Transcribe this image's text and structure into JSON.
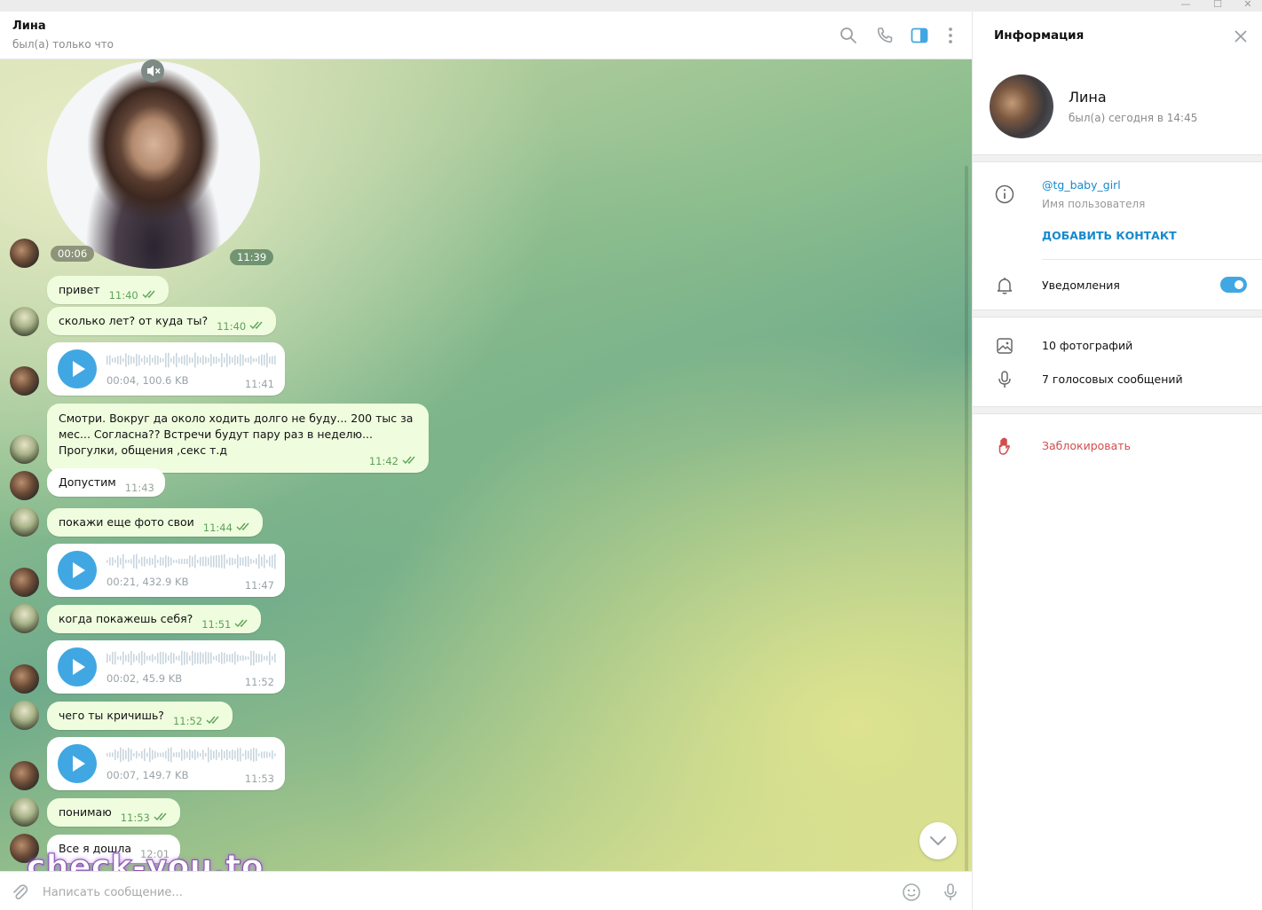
{
  "header": {
    "title": "Лина",
    "status": "был(а) только что"
  },
  "messages": {
    "video_round": {
      "duration": "00:06",
      "time": "11:39"
    },
    "m1": {
      "text": "привет",
      "time": "11:40"
    },
    "m2": {
      "text": "сколько лет? от куда ты?",
      "time": "11:40"
    },
    "v1": {
      "meta": "00:04, 100.6 KB",
      "time": "11:41"
    },
    "m3": {
      "text": "Смотри. Вокруг да около ходить долго не буду... 200 тыс за мес... Согласна?? Встречи будут пару раз в неделю... Прогулки, общения ,секс  т.д",
      "time": "11:42"
    },
    "m4": {
      "text": "Допустим",
      "time": "11:43"
    },
    "m5": {
      "text": "покажи еще фото свои",
      "time": "11:44"
    },
    "v2": {
      "meta": "00:21, 432.9 KB",
      "time": "11:47"
    },
    "m6": {
      "text": "когда покажешь себя?",
      "time": "11:51"
    },
    "v3": {
      "meta": "00:02, 45.9 KB",
      "time": "11:52"
    },
    "m7": {
      "text": "чего ты кричишь?",
      "time": "11:52"
    },
    "v4": {
      "meta": "00:07, 149.7 KB",
      "time": "11:53"
    },
    "m8": {
      "text": "понимаю",
      "time": "11:53"
    },
    "m9": {
      "text": "Все я дошла",
      "time": "12:01"
    }
  },
  "composer": {
    "placeholder": "Написать сообщение..."
  },
  "watermark": "check-you.to",
  "panel": {
    "title": "Информация",
    "name": "Лина",
    "status": "был(а) сегодня в 14:45",
    "username": "@tg_baby_girl",
    "username_label": "Имя пользователя",
    "add_contact": "ДОБАВИТЬ КОНТАКТ",
    "notifications": "Уведомления",
    "notifications_on": true,
    "photos": "10 фотографий",
    "voices": "7 голосовых сообщений",
    "block": "Заблокировать"
  },
  "colors": {
    "accent": "#40a7e3",
    "link": "#168acd",
    "outgoing_bubble": "#effdde",
    "time_read": "#5fa15a",
    "danger": "#d14e4e"
  },
  "icons": [
    "search-icon",
    "phone-icon",
    "sidebar-toggle-icon",
    "more-vertical-icon",
    "attach-icon",
    "emoji-icon",
    "microphone-icon",
    "close-icon",
    "info-icon",
    "bell-icon",
    "photo-icon",
    "microphone-icon",
    "hand-block-icon",
    "chevron-down-icon",
    "mute-icon",
    "play-icon"
  ]
}
